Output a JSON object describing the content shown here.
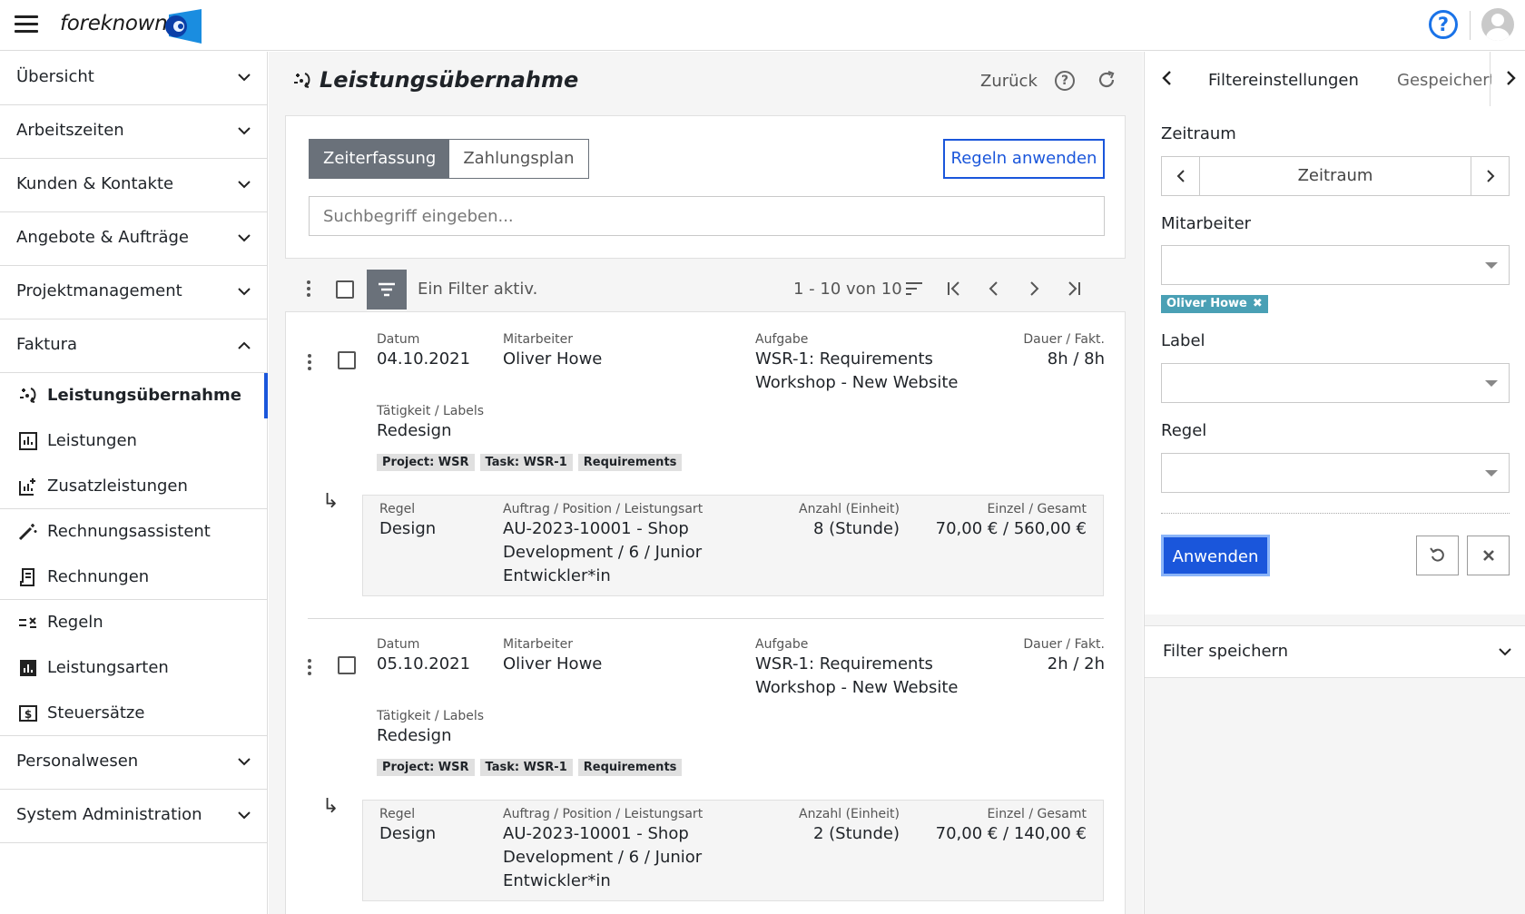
{
  "app": {
    "name": "foreknown"
  },
  "sidebar": {
    "groups": [
      {
        "label": "Übersicht"
      },
      {
        "label": "Arbeitszeiten"
      },
      {
        "label": "Kunden & Kontakte"
      },
      {
        "label": "Angebote & Aufträge"
      },
      {
        "label": "Projektmanagement"
      },
      {
        "label": "Faktura"
      },
      {
        "label": "Personalwesen"
      },
      {
        "label": "System Administration"
      }
    ],
    "faktura_items": [
      {
        "label": "Leistungsübernahme",
        "icon": "transfer-icon",
        "active": true
      },
      {
        "label": "Leistungen",
        "icon": "chart-icon"
      },
      {
        "label": "Zusatzleistungen",
        "icon": "chart-plus-icon"
      },
      {
        "label": "Rechnungsassistent",
        "icon": "magic-wand-icon"
      },
      {
        "label": "Rechnungen",
        "icon": "receipt-icon"
      },
      {
        "label": "Regeln",
        "icon": "rules-icon"
      },
      {
        "label": "Leistungsarten",
        "icon": "bar-chart-icon"
      },
      {
        "label": "Steuersätze",
        "icon": "tax-icon"
      }
    ]
  },
  "main": {
    "title": "Leistungsübernahme",
    "back": "Zurück",
    "tabs": [
      "Zeiterfassung",
      "Zahlungsplan"
    ],
    "rules_button": "Regeln anwenden",
    "search_placeholder": "Suchbegriff eingeben...",
    "filter_status": "Ein Filter aktiv.",
    "pagination": "1 - 10 von 10",
    "labels": {
      "date": "Datum",
      "employee": "Mitarbeiter",
      "task": "Aufgabe",
      "duration": "Dauer / Fakt.",
      "activity": "Tätigkeit / Labels",
      "rule": "Regel",
      "order": "Auftrag / Position / Leistungsart",
      "quantity": "Anzahl (Einheit)",
      "price": "Einzel / Gesamt"
    },
    "entries": [
      {
        "date": "04.10.2021",
        "employee": "Oliver Howe",
        "task_line1": "WSR-1: Requirements",
        "task_line2": "Workshop - New Website",
        "duration": "8h / 8h",
        "activity": "Redesign",
        "tags": [
          "Project: WSR",
          "Task: WSR-1",
          "Requirements"
        ],
        "rule": "Design",
        "order_line1": "AU-2023-10001 - Shop",
        "order_line2": "Development / 6 / Junior",
        "order_line3": "Entwickler*in",
        "quantity": "8 (Stunde)",
        "price": "70,00 € / 560,00 €"
      },
      {
        "date": "05.10.2021",
        "employee": "Oliver Howe",
        "task_line1": "WSR-1: Requirements",
        "task_line2": "Workshop - New Website",
        "duration": "2h / 2h",
        "activity": "Redesign",
        "tags": [
          "Project: WSR",
          "Task: WSR-1",
          "Requirements"
        ],
        "rule": "Design",
        "order_line1": "AU-2023-10001 - Shop",
        "order_line2": "Development / 6 / Junior",
        "order_line3": "Entwickler*in",
        "quantity": "2 (Stunde)",
        "price": "70,00 € / 140,00 €"
      }
    ]
  },
  "right_panel": {
    "tab_filter": "Filtereinstellungen",
    "tab_saved": "Gespeicherte",
    "zeitraum_label": "Zeitraum",
    "zeitraum_value": "Zeitraum",
    "employee_label": "Mitarbeiter",
    "employee_chip": "Oliver Howe",
    "label_label": "Label",
    "rule_label": "Regel",
    "apply": "Anwenden",
    "save_filter": "Filter speichern"
  },
  "colors": {
    "accent": "#1a56db",
    "chip": "#4aa0b5",
    "segment": "#6a717a"
  }
}
